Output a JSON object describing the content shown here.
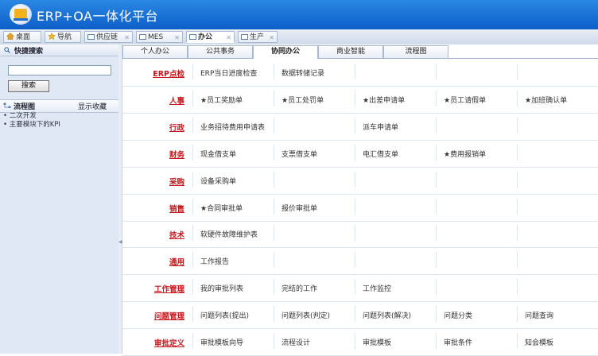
{
  "app": {
    "title": "ERP+OA一体化平台"
  },
  "main_tabs": [
    {
      "label": "桌面",
      "icon": "home-icon"
    },
    {
      "label": "导航",
      "icon": "star-icon"
    },
    {
      "label": "供应链",
      "icon": "window-icon"
    },
    {
      "label": "MES",
      "icon": "window-icon"
    },
    {
      "label": "办公",
      "icon": "window-icon",
      "active": true
    },
    {
      "label": "生产",
      "icon": "window-icon"
    }
  ],
  "sidebar": {
    "quick_search_title": "快捷搜索",
    "search_input": {
      "value": "",
      "placeholder": ""
    },
    "search_button": "搜索",
    "flow_title": "流程图",
    "show_favorites": "显示收藏",
    "flow_items": [
      "• 二次开发",
      "• 主要模块下的KPI"
    ]
  },
  "sub_tabs": [
    "个人办公",
    "公共事务",
    "协同办公",
    "商业智能",
    "流程图"
  ],
  "active_sub_tab": 2,
  "rows": [
    {
      "category": "ERP点检",
      "items": [
        "ERP当日进度检查",
        "数据转储记录",
        "",
        "",
        ""
      ]
    },
    {
      "category": "人事",
      "items": [
        "★员工奖励单",
        "★员工处罚单",
        "★出差申请单",
        "★员工请假单",
        "★加班确认单"
      ]
    },
    {
      "category": "行政",
      "items": [
        "业务招待费用申请表",
        "",
        "派车申请单",
        "",
        ""
      ]
    },
    {
      "category": "财务",
      "items": [
        "现金借支单",
        "支票借支单",
        "电汇借支单",
        "★费用报销单",
        ""
      ]
    },
    {
      "category": "采购",
      "items": [
        "设备采购单",
        "",
        "",
        "",
        ""
      ]
    },
    {
      "category": "销售",
      "items": [
        "★合同审批单",
        "报价审批单",
        "",
        "",
        ""
      ]
    },
    {
      "category": "技术",
      "items": [
        "软硬件故障维护表",
        "",
        "",
        "",
        ""
      ]
    },
    {
      "category": "通用",
      "items": [
        "工作报告",
        "",
        "",
        "",
        ""
      ]
    },
    {
      "category": "工作管理",
      "items": [
        "我的审批列表",
        "完结的工作",
        "工作监控",
        "",
        ""
      ]
    },
    {
      "category": "问题管理",
      "items": [
        "问题列表(提出)",
        "问题列表(判定)",
        "问题列表(解决)",
        "问题分类",
        "问题查询"
      ]
    },
    {
      "category": "审批定义",
      "items": [
        "审批模板向导",
        "流程设计",
        "审批模板",
        "审批条件",
        "知会模板"
      ]
    }
  ],
  "colors": {
    "header": "#0d5fc8",
    "category_red": "#c8161d",
    "panel_bg": "#dfe8f4"
  }
}
